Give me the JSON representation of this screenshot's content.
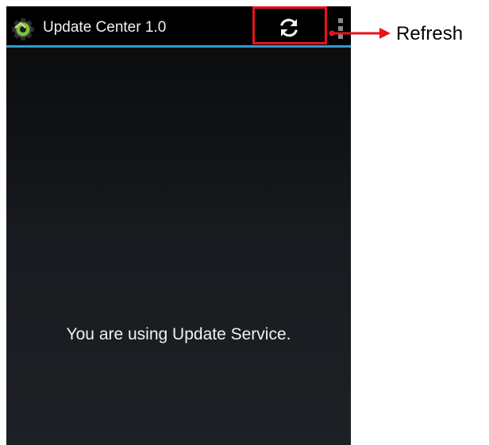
{
  "app_bar": {
    "title": "Update Center 1.0",
    "app_icon": "gear-icon",
    "refresh_icon": "refresh-icon",
    "overflow_icon": "overflow-menu-icon",
    "accent_color": "#2f9bd0"
  },
  "main": {
    "message": "You are using Update Service."
  },
  "annotation": {
    "label": "Refresh",
    "highlight_color": "#e8121d"
  }
}
